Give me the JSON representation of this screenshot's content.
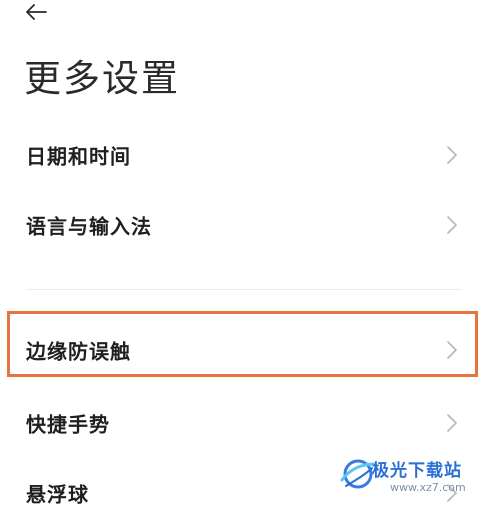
{
  "header": {
    "back_icon": "arrow-left-icon",
    "title": "更多设置"
  },
  "settings": {
    "items": [
      {
        "label": "日期和时间",
        "icon": "chevron-right-icon"
      },
      {
        "label": "语言与输入法",
        "icon": "chevron-right-icon"
      },
      {
        "label": "边缘防误触",
        "icon": "chevron-right-icon",
        "highlighted": true
      },
      {
        "label": "快捷手势",
        "icon": "chevron-right-icon"
      },
      {
        "label": "悬浮球",
        "icon": "chevron-right-icon"
      }
    ]
  },
  "highlight": {
    "color": "#e8723c"
  },
  "watermark": {
    "name": "极光下载站",
    "url": "www.xz7.com"
  }
}
